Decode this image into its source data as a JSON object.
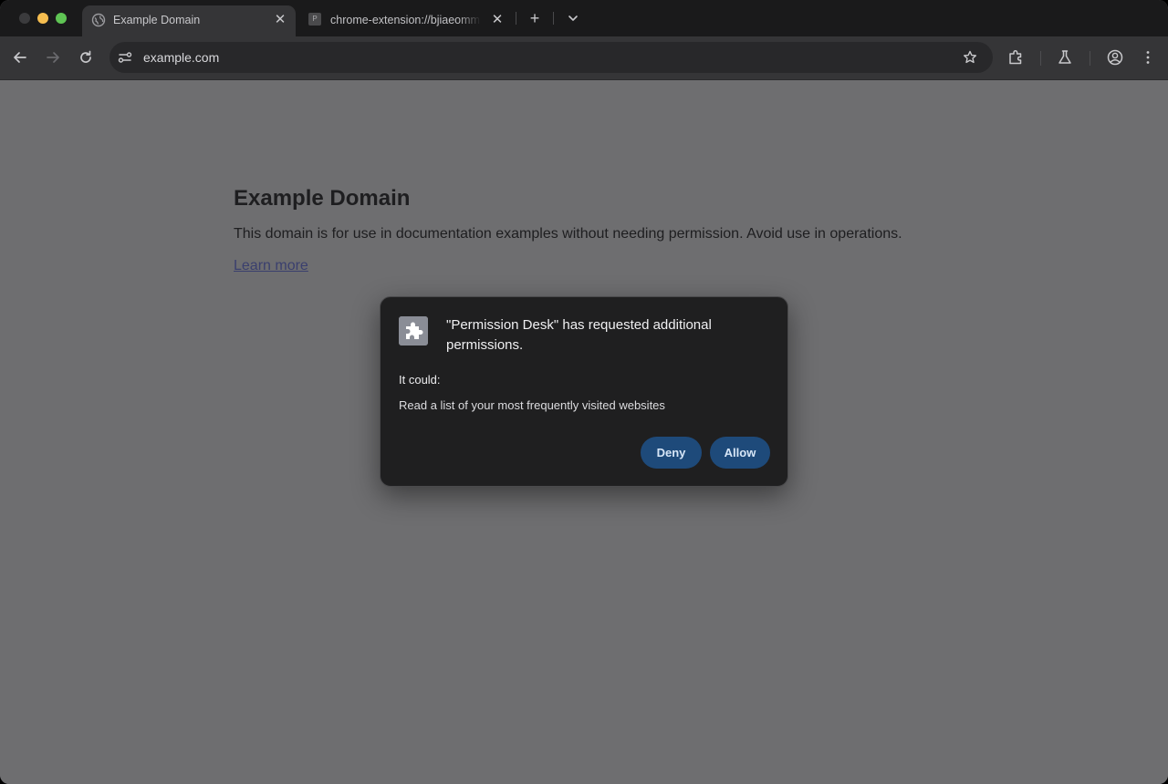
{
  "tabs": [
    {
      "title": "Example Domain",
      "favicon": "globe-icon",
      "active": true
    },
    {
      "title": "chrome-extension://bjiaeomm",
      "favicon": "extension-letter-icon",
      "favicon_letter": "P",
      "active": false
    }
  ],
  "toolbar": {
    "url": "example.com"
  },
  "page": {
    "heading": "Example Domain",
    "description": "This domain is for use in documentation examples without needing permission. Avoid use in operations.",
    "link_text": "Learn more"
  },
  "dialog": {
    "title": "\"Permission Desk\" has requested additional permissions.",
    "subtitle": "It could:",
    "permission": "Read a list of your most frequently visited websites",
    "deny_label": "Deny",
    "allow_label": "Allow",
    "icon": "puzzle-piece-icon"
  },
  "colors": {
    "traffic_close": "#3b3b3d",
    "traffic_minimize": "#f5bd4f",
    "traffic_maximize": "#5fc454",
    "button_bg": "#1e4a7a",
    "dimmed_page": "#6e6e70"
  }
}
